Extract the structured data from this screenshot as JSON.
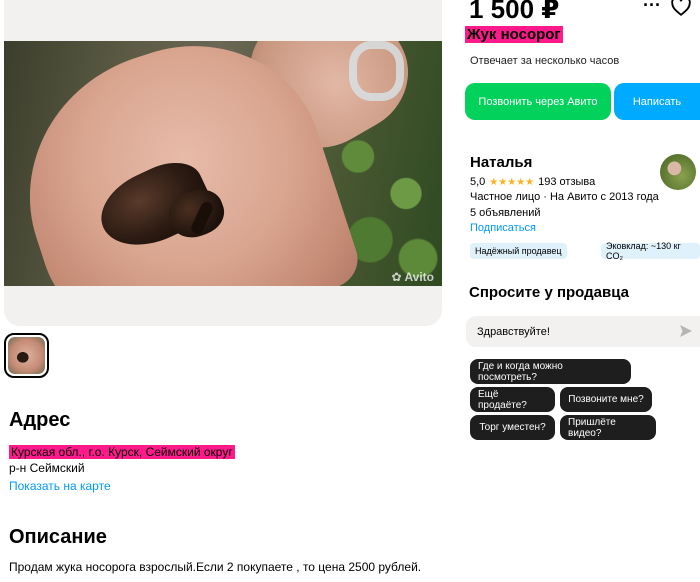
{
  "listing": {
    "price": "1 500 ₽",
    "title": "Жук носорог",
    "responds": "Отвечает за несколько часов",
    "watermark": "Avito"
  },
  "actions": {
    "call_label": "Позвонить через Авито",
    "write_label": "Написать"
  },
  "seller": {
    "name": "Наталья",
    "rating": "5,0",
    "stars": "★★★★★",
    "reviews": "193 отзыва",
    "type": "Частное лицо · На Авито с 2013 года",
    "ads": "5 объявлений",
    "subscribe": "Подписаться",
    "badges": [
      "Надёжный продавец",
      "Эковклад: ~130 кг CO₂"
    ]
  },
  "ask": {
    "heading": "Спросите у продавца",
    "message": "Здравствуйте!",
    "chips": [
      "Где и когда можно посмотреть?",
      "Ещё продаёте?",
      "Позвоните мне?",
      "Торг уместен?",
      "Пришлёте видео?"
    ]
  },
  "address": {
    "heading": "Адрес",
    "line": "Курская обл., г.о. Курск, Сеймский округ",
    "district": "р-н Сеймский",
    "map_link": "Показать на карте"
  },
  "description": {
    "heading": "Описание",
    "text": "Продам жука носорога взрослый.Если 2 покупаете , то цена 2500 рублей."
  },
  "colors": {
    "call": "#02d15c",
    "write": "#00aaff",
    "link": "#0099f7",
    "highlight": "#ff1a8c",
    "stars": "#ffb021"
  },
  "icons": [
    "more-icon",
    "heart-icon",
    "send-icon"
  ]
}
